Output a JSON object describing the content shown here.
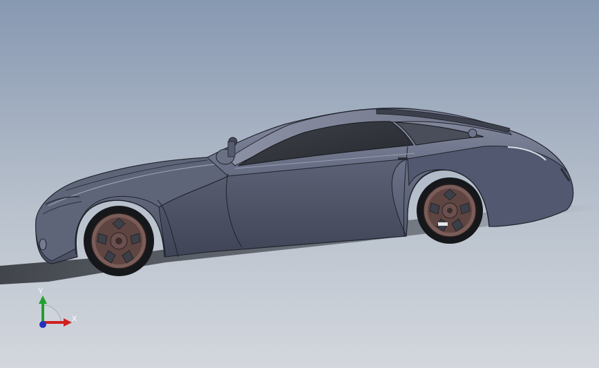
{
  "viewport": {
    "background_top": "#8798b1",
    "background_mid": "#b7c0cc",
    "background_bottom": "#d3d7dd"
  },
  "model": {
    "body_color": "#4d5367",
    "body_highlight": "#7d859b",
    "glass_color": "#2f3238",
    "wheel_color": "#7a5c58",
    "tire_color": "#15171a"
  },
  "triad": {
    "x_label": "X",
    "y_label": "Y",
    "x_color": "#d02020",
    "y_color": "#20a030",
    "z_color": "#2030c0"
  }
}
